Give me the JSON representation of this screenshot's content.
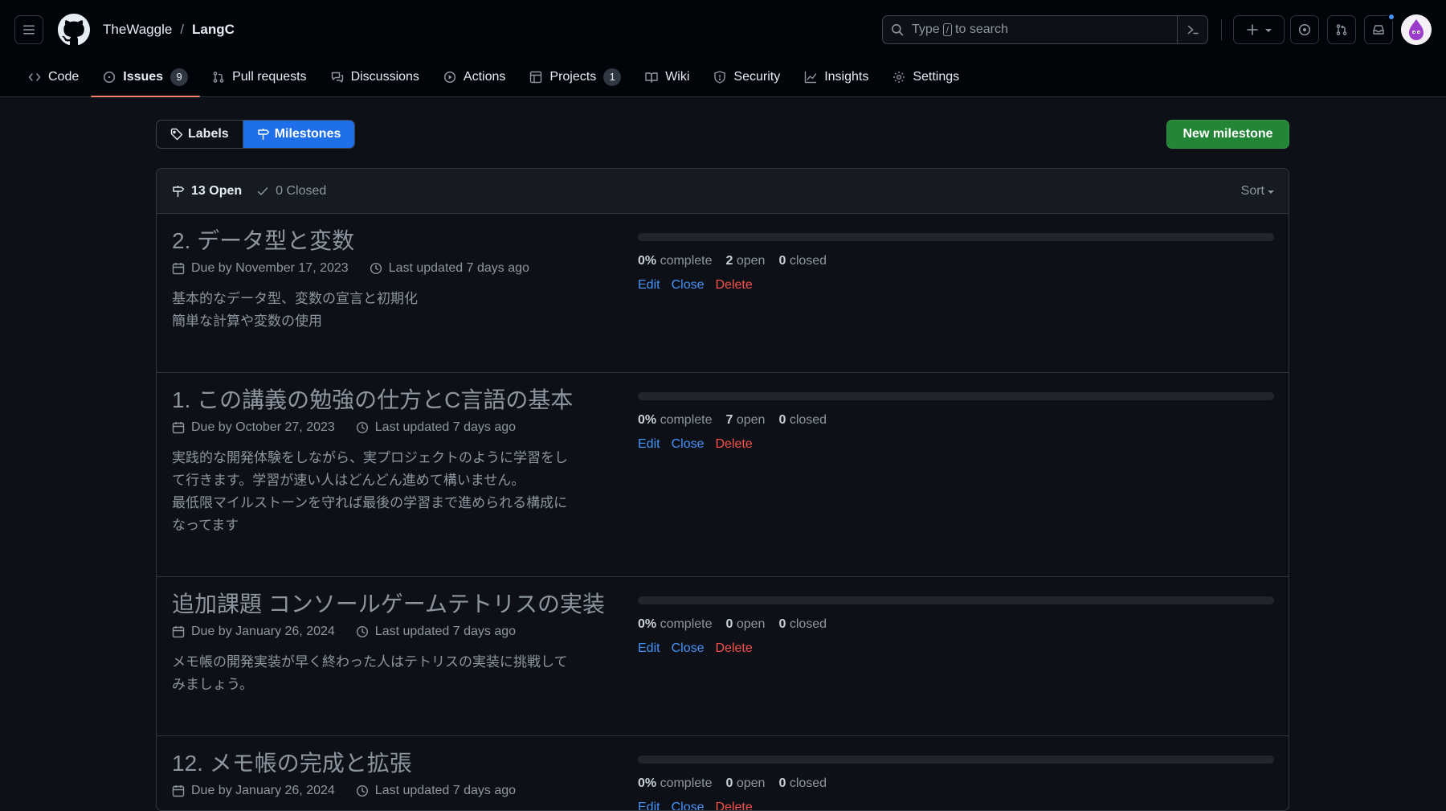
{
  "header": {
    "owner": "TheWaggle",
    "separator": "/",
    "repo": "LangC",
    "search": {
      "before": "Type",
      "key": "/",
      "after": "to search"
    }
  },
  "repo_nav": [
    {
      "label": "Code",
      "icon": "code-icon"
    },
    {
      "label": "Issues",
      "icon": "issue-opened-icon",
      "counter": "9",
      "active": true
    },
    {
      "label": "Pull requests",
      "icon": "git-pull-request-icon"
    },
    {
      "label": "Discussions",
      "icon": "comment-discussion-icon"
    },
    {
      "label": "Actions",
      "icon": "play-icon"
    },
    {
      "label": "Projects",
      "icon": "table-icon",
      "counter": "1"
    },
    {
      "label": "Wiki",
      "icon": "book-icon"
    },
    {
      "label": "Security",
      "icon": "shield-icon"
    },
    {
      "label": "Insights",
      "icon": "graph-icon"
    },
    {
      "label": "Settings",
      "icon": "gear-icon"
    }
  ],
  "subnav": {
    "labels": "Labels",
    "milestones": "Milestones"
  },
  "new_milestone": "New milestone",
  "list_header": {
    "open": "13 Open",
    "closed": "0 Closed",
    "sort": "Sort"
  },
  "milestones": [
    {
      "title": "2. データ型と変数",
      "due": "Due by November 17, 2023",
      "updated": "Last updated 7 days ago",
      "description": "基本的なデータ型、変数の宣言と初期化\n簡単な計算や変数の使用",
      "progress": 0,
      "complete_pct": "0%",
      "complete_label": "complete",
      "open_count": "2",
      "open_label": "open",
      "closed_count": "0",
      "closed_label": "closed",
      "edit": "Edit",
      "close": "Close",
      "delete": "Delete"
    },
    {
      "title": "1. この講義の勉強の仕方とC言語の基本",
      "due": "Due by October 27, 2023",
      "updated": "Last updated 7 days ago",
      "description": "実践的な開発体験をしながら、実プロジェクトのように学習をし\nて行きます。学習が速い人はどんどん進めて構いません。\n最低限マイルストーンを守れば最後の学習まで進められる構成に\nなってます",
      "progress": 0,
      "complete_pct": "0%",
      "complete_label": "complete",
      "open_count": "7",
      "open_label": "open",
      "closed_count": "0",
      "closed_label": "closed",
      "edit": "Edit",
      "close": "Close",
      "delete": "Delete"
    },
    {
      "title": "追加課題 コンソールゲームテトリスの実装",
      "due": "Due by January 26, 2024",
      "updated": "Last updated 7 days ago",
      "description": "メモ帳の開発実装が早く終わった人はテトリスの実装に挑戦して\nみましょう。",
      "progress": 0,
      "complete_pct": "0%",
      "complete_label": "complete",
      "open_count": "0",
      "open_label": "open",
      "closed_count": "0",
      "closed_label": "closed",
      "edit": "Edit",
      "close": "Close",
      "delete": "Delete"
    },
    {
      "title": "12. メモ帳の完成と拡張",
      "due": "Due by January 26, 2024",
      "updated": "Last updated 7 days ago",
      "description": "",
      "progress": 0,
      "complete_pct": "0%",
      "complete_label": "complete",
      "open_count": "0",
      "open_label": "open",
      "closed_count": "0",
      "closed_label": "closed",
      "edit": "Edit",
      "close": "Close",
      "delete": "Delete"
    }
  ]
}
